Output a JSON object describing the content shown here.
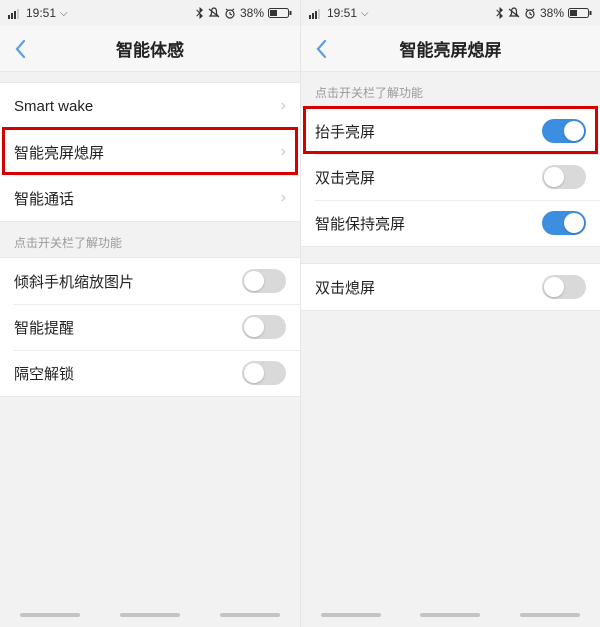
{
  "status": {
    "time": "19:51",
    "battery_pct": "38%"
  },
  "left": {
    "title": "智能体感",
    "group1": [
      {
        "label": "Smart wake",
        "type": "nav"
      },
      {
        "label": "智能亮屏熄屏",
        "type": "nav",
        "highlight": true
      },
      {
        "label": "智能通话",
        "type": "nav"
      }
    ],
    "hint": "点击开关栏了解功能",
    "group2": [
      {
        "label": "倾斜手机缩放图片",
        "type": "toggle",
        "on": false
      },
      {
        "label": "智能提醒",
        "type": "toggle",
        "on": false
      },
      {
        "label": "隔空解锁",
        "type": "toggle",
        "on": false
      }
    ]
  },
  "right": {
    "title": "智能亮屏熄屏",
    "hint": "点击开关栏了解功能",
    "group1": [
      {
        "label": "抬手亮屏",
        "type": "toggle",
        "on": true,
        "highlight": true
      },
      {
        "label": "双击亮屏",
        "type": "toggle",
        "on": false
      },
      {
        "label": "智能保持亮屏",
        "type": "toggle",
        "on": true
      }
    ],
    "group2": [
      {
        "label": "双击熄屏",
        "type": "toggle",
        "on": false
      }
    ]
  }
}
